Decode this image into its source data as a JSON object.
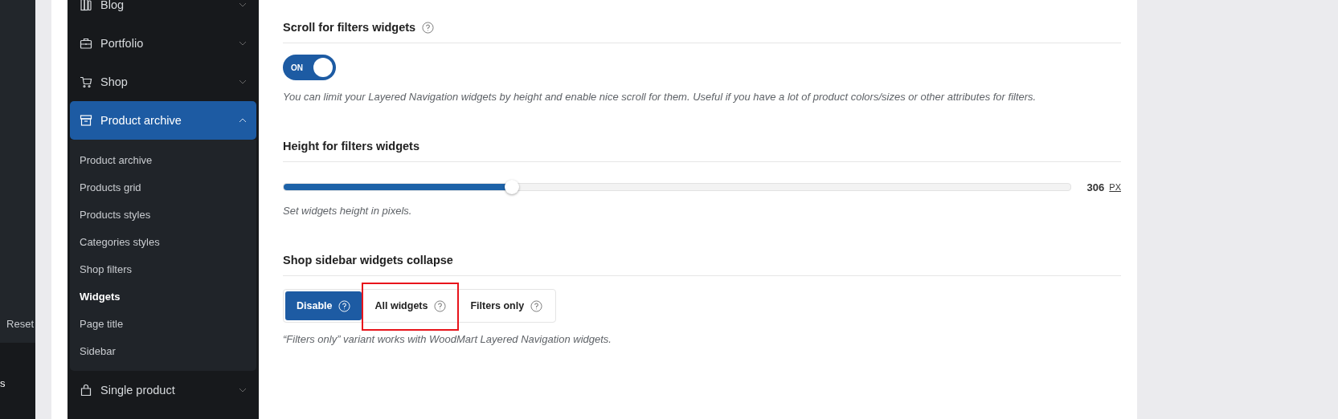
{
  "left_panel": {
    "reset_label": "Reset",
    "bottom_label": "s"
  },
  "sidebar": {
    "items": [
      {
        "label": "Blog",
        "expanded": false,
        "selected": false
      },
      {
        "label": "Portfolio",
        "expanded": false,
        "selected": false
      },
      {
        "label": "Shop",
        "expanded": false,
        "selected": false
      },
      {
        "label": "Product archive",
        "expanded": true,
        "selected": true,
        "children": [
          {
            "label": "Product archive",
            "selected": false
          },
          {
            "label": "Products grid",
            "selected": false
          },
          {
            "label": "Products styles",
            "selected": false
          },
          {
            "label": "Categories styles",
            "selected": false
          },
          {
            "label": "Shop filters",
            "selected": false
          },
          {
            "label": "Widgets",
            "selected": true
          },
          {
            "label": "Page title",
            "selected": false
          },
          {
            "label": "Sidebar",
            "selected": false
          }
        ]
      },
      {
        "label": "Single product",
        "expanded": false,
        "selected": false
      }
    ]
  },
  "settings": [
    {
      "kind": "switch",
      "title": "Scroll for filters widgets",
      "help": true,
      "on": true,
      "switch_label": "ON",
      "description": "You can limit your Layered Navigation widgets by height and enable nice scroll for them. Useful if you have a lot of product colors/sizes or other attributes for filters."
    },
    {
      "kind": "slider",
      "title": "Height for filters widgets",
      "help": false,
      "level": 0.29,
      "value": "306",
      "unit": "PX",
      "description": "Set widgets height in pixels."
    },
    {
      "kind": "buttons",
      "title": "Shop sidebar widgets collapse",
      "help": false,
      "options": [
        {
          "label": "Disable",
          "selected": true,
          "highlighted": false
        },
        {
          "label": "All widgets",
          "selected": false,
          "highlighted": true
        },
        {
          "label": "Filters only",
          "selected": false,
          "highlighted": false
        }
      ],
      "description": "“Filters only” variant works with WoodMart Layered Navigation widgets."
    }
  ]
}
